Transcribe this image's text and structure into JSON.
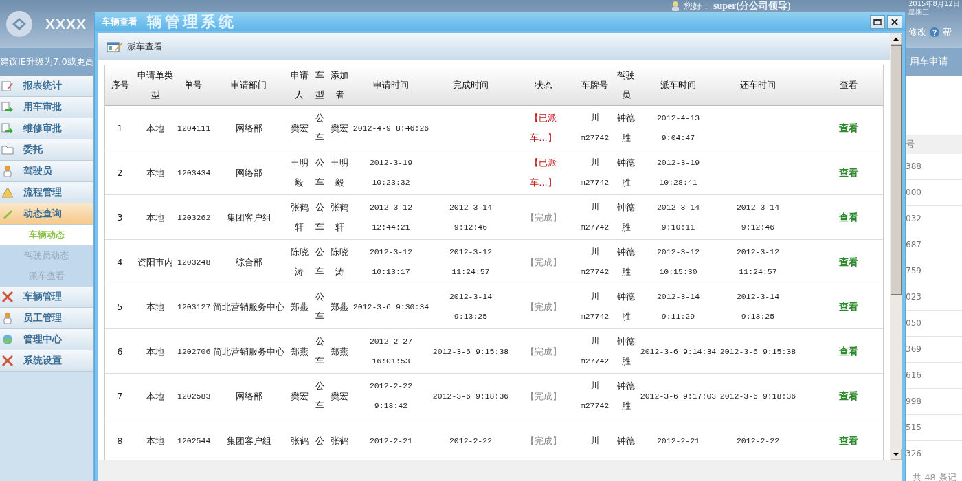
{
  "header": {
    "title": "XXXX",
    "greeting": "您好：",
    "user": "super(分公司领导)",
    "date": "2015年8月12日",
    "weekday": "星期三"
  },
  "notice": "建议IE升级为7.0或更高",
  "top_links": [
    {
      "label": "修改"
    },
    {
      "label": "帮"
    }
  ],
  "top_tab": {
    "label": "用车申请"
  },
  "sidebar": {
    "items": [
      {
        "label": "报表统计",
        "selected": false
      },
      {
        "label": "用车审批",
        "selected": false
      },
      {
        "label": "维修审批",
        "selected": false
      },
      {
        "label": "委托",
        "selected": false
      },
      {
        "label": "驾驶员",
        "selected": false
      },
      {
        "label": "流程管理",
        "selected": false
      },
      {
        "label": "动态查询",
        "selected": true,
        "expanded": true,
        "children": [
          {
            "label": "车辆动态",
            "selected": true
          },
          {
            "label": "驾驶员动态",
            "selected": false
          },
          {
            "label": "派车查看",
            "selected": false
          }
        ]
      },
      {
        "label": "车辆管理",
        "selected": false
      },
      {
        "label": "员工管理",
        "selected": false
      },
      {
        "label": "管理中心",
        "selected": false
      },
      {
        "label": "系统设置",
        "selected": false
      }
    ]
  },
  "background_list": {
    "heading": "号",
    "cells": [
      "388",
      "000",
      "032",
      "687",
      "759",
      "023",
      "050",
      "369",
      "616",
      "998",
      "515",
      "326"
    ],
    "footer": "共 48 条记"
  },
  "dialog": {
    "title": "车辆查看",
    "ghost_title": "辆管理系统",
    "toolbar_label": "派车查看",
    "columns": [
      "序号",
      "申请单类型",
      "单号",
      "申请部门",
      "申请人",
      "车型",
      "添加者",
      "申请时间",
      "完成时间",
      "状态",
      "车牌号",
      "驾驶员",
      "派车时间",
      "还车时间",
      "查看"
    ],
    "rows": [
      {
        "no": "1",
        "type": "本地",
        "order": "1204111",
        "dept": "网络部",
        "applicant": "樊宏",
        "vehicle": "公车",
        "added_by": "樊宏",
        "apply_time": "2012-4-9 8:46:26",
        "status": "【已派车...】",
        "dispatched": true,
        "plate": "川 m27742",
        "driver": "钟德胜",
        "dispatch_time": "2012-4-13 9:04:47",
        "action": "查看"
      },
      {
        "no": "2",
        "type": "本地",
        "order": "1203434",
        "dept": "网络部",
        "applicant": "王明毅",
        "vehicle": "公车",
        "added_by": "王明毅",
        "apply_time": "2012-3-19 10:23:32",
        "status": "【已派车...】",
        "dispatched": true,
        "plate": "川 m27742",
        "driver": "钟德胜",
        "dispatch_time": "2012-3-19 10:28:41",
        "action": "查看"
      },
      {
        "no": "3",
        "type": "本地",
        "order": "1203262",
        "dept": "集团客户组",
        "applicant": "张鹤轩",
        "vehicle": "公车",
        "added_by": "张鹤轩",
        "apply_time": "2012-3-12 12:44:21",
        "finish_time": "2012-3-14 9:12:46",
        "status": "【完成】",
        "dispatched": false,
        "plate": "川 m27742",
        "driver": "钟德胜",
        "dispatch_time": "2012-3-14 9:10:11",
        "return_time": "2012-3-14 9:12:46",
        "action": "查看"
      },
      {
        "no": "4",
        "type": "资阳市内",
        "order": "1203248",
        "dept": "综合部",
        "applicant": "陈晓涛",
        "vehicle": "公车",
        "added_by": "陈晓涛",
        "apply_time": "2012-3-12 10:13:17",
        "finish_time": "2012-3-12 11:24:57",
        "status": "【完成】",
        "dispatched": false,
        "plate": "川 m27742",
        "driver": "钟德胜",
        "dispatch_time": "2012-3-12 10:15:30",
        "return_time": "2012-3-12 11:24:57",
        "action": "查看"
      },
      {
        "no": "5",
        "type": "本地",
        "order": "1203127",
        "dept": "简北营销服务中心",
        "applicant": "郑燕",
        "vehicle": "公车",
        "added_by": "郑燕",
        "apply_time": "2012-3-6 9:30:34",
        "finish_time": "2012-3-14 9:13:25",
        "status": "【完成】",
        "dispatched": false,
        "plate": "川 m27742",
        "driver": "钟德胜",
        "dispatch_time": "2012-3-14 9:11:29",
        "return_time": "2012-3-14 9:13:25",
        "action": "查看"
      },
      {
        "no": "6",
        "type": "本地",
        "order": "1202706",
        "dept": "简北营销服务中心",
        "applicant": "郑燕",
        "vehicle": "公车",
        "added_by": "郑燕",
        "apply_time": "2012-2-27 16:01:53",
        "finish_time": "2012-3-6 9:15:38",
        "status": "【完成】",
        "dispatched": false,
        "plate": "川 m27742",
        "driver": "钟德胜",
        "dispatch_time": "2012-3-6 9:14:34",
        "return_time": "2012-3-6 9:15:38",
        "action": "查看"
      },
      {
        "no": "7",
        "type": "本地",
        "order": "1202583",
        "dept": "网络部",
        "applicant": "樊宏",
        "vehicle": "公车",
        "added_by": "樊宏",
        "apply_time": "2012-2-22 9:18:42",
        "finish_time": "2012-3-6 9:18:36",
        "status": "【完成】",
        "dispatched": false,
        "plate": "川 m27742",
        "driver": "钟德胜",
        "dispatch_time": "2012-3-6 9:17:03",
        "return_time": "2012-3-6 9:18:36",
        "action": "查看"
      },
      {
        "no": "8",
        "type": "本地",
        "order": "1202544",
        "dept": "集团客户组",
        "applicant": "张鹤",
        "vehicle": "公",
        "added_by": "张鹤",
        "apply_time": "2012-2-21",
        "finish_time": "2012-2-22",
        "status": "【完成】",
        "dispatched": false,
        "plate": "川",
        "driver": "钟德",
        "dispatch_time": "2012-2-21",
        "return_time": "2012-2-22",
        "action": "查看"
      }
    ]
  }
}
